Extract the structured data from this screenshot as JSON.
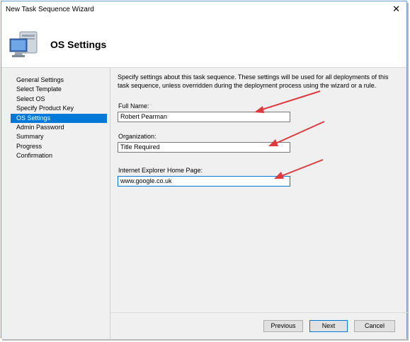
{
  "window": {
    "title": "New Task Sequence Wizard"
  },
  "header": {
    "title": "OS Settings",
    "icon": "computer-icon"
  },
  "nav": {
    "items": [
      {
        "label": "General Settings"
      },
      {
        "label": "Select Template"
      },
      {
        "label": "Select OS"
      },
      {
        "label": "Specify Product Key"
      },
      {
        "label": "OS Settings"
      },
      {
        "label": "Admin Password"
      },
      {
        "label": "Summary"
      },
      {
        "label": "Progress"
      },
      {
        "label": "Confirmation"
      }
    ],
    "active_label": "OS Settings"
  },
  "content": {
    "description": "Specify settings about this task sequence.  These settings will be used for all deployments of this task sequence, unless overridden during the deployment process using the wizard or a rule.",
    "full_name": {
      "label": "Full Name:",
      "value": "Robert Pearman"
    },
    "organization": {
      "label": "Organization:",
      "value": "Title Required"
    },
    "home_page": {
      "label": "Internet Explorer Home Page:",
      "value": "www.google.co.uk"
    }
  },
  "buttons": {
    "previous": "Previous",
    "next": "Next",
    "cancel": "Cancel"
  },
  "colors": {
    "accent": "#0078d7",
    "arrow": "#e0393e",
    "body_bg": "#f0f0f0"
  }
}
